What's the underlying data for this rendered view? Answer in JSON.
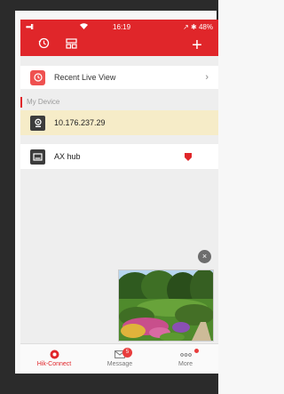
{
  "status_bar": {
    "signal": "•••ll",
    "wifi_icon": "wifi-icon",
    "time": "16:19",
    "right": "↗ ✱ 48%"
  },
  "toolbar": {
    "history_icon": "history-icon",
    "layout_icon": "layout-icon",
    "add_label": "+"
  },
  "recent": {
    "label": "Recent Live View",
    "chevron": "›"
  },
  "section": {
    "label": "My Device"
  },
  "devices": [
    {
      "label": "10.176.237.29",
      "icon": "camera-device-icon",
      "selected": true
    },
    {
      "label": "AX hub",
      "icon": "hub-device-icon",
      "badge_icon": "shield-icon"
    }
  ],
  "preview": {
    "close_label": "×"
  },
  "tabbar": {
    "tabs": [
      {
        "label": "Hik-Connect",
        "icon": "hik-connect-icon",
        "active": true
      },
      {
        "label": "Message",
        "icon": "envelope-icon",
        "badge": "5"
      },
      {
        "label": "More",
        "icon": "more-icon"
      }
    ]
  },
  "colors": {
    "brand": "#e0262a",
    "selected_row": "#f6ecc8"
  }
}
